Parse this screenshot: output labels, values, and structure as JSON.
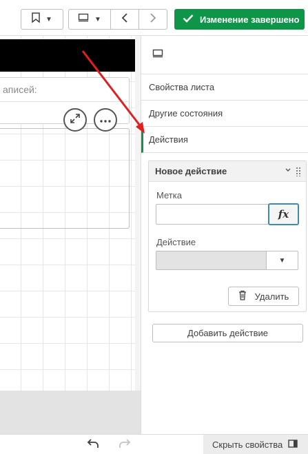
{
  "toolbar": {
    "done_label": "Изменение завершено",
    "done_color": "#0f9548"
  },
  "canvas": {
    "table_label": "аписей:"
  },
  "panel": {
    "items": [
      {
        "label": "Свойства листа"
      },
      {
        "label": "Другие состояния"
      },
      {
        "label": "Действия"
      }
    ],
    "action": {
      "title": "Новое действие",
      "label_field_title": "Метка",
      "label_field_value": "",
      "fx_label": "fx",
      "action_field_title": "Действие",
      "delete_label": "Удалить"
    },
    "add_action_label": "Добавить действие"
  },
  "footer": {
    "hide_properties_label": "Скрыть свойства"
  },
  "icons": {
    "bookmark": "bookmark-icon",
    "sheet": "sheet-icon",
    "prev": "chevron-left-icon",
    "next": "chevron-right-icon",
    "check": "check-icon",
    "expand": "expand-icon",
    "more": "more-icon",
    "trash": "trash-icon",
    "undo": "undo-icon",
    "redo": "redo-icon",
    "panel": "panel-icon"
  },
  "colors": {
    "accent": "#0f9548",
    "annotation_arrow": "#e02020"
  }
}
